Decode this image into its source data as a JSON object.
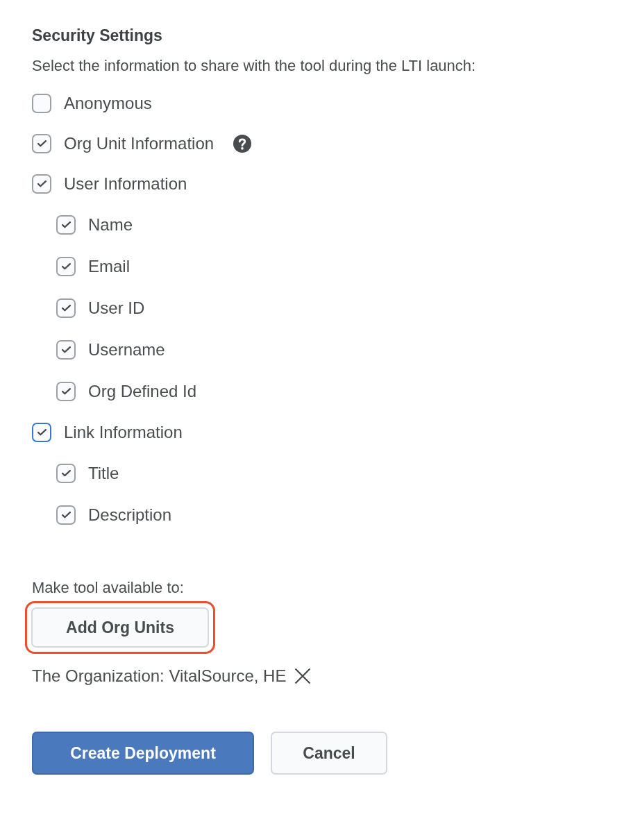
{
  "heading": "Security Settings",
  "instructions": "Select the information to share with the tool during the LTI launch:",
  "options": [
    {
      "label": "Anonymous",
      "checked": false,
      "focused": false,
      "help": false
    },
    {
      "label": "Org Unit Information",
      "checked": true,
      "focused": false,
      "help": true
    },
    {
      "label": "User Information",
      "checked": true,
      "focused": false,
      "help": false,
      "children": [
        {
          "label": "Name",
          "checked": true,
          "focused": false,
          "help": false
        },
        {
          "label": "Email",
          "checked": true,
          "focused": false,
          "help": false
        },
        {
          "label": "User ID",
          "checked": true,
          "focused": false,
          "help": false
        },
        {
          "label": "Username",
          "checked": true,
          "focused": false,
          "help": false
        },
        {
          "label": "Org Defined Id",
          "checked": true,
          "focused": false,
          "help": false
        }
      ]
    },
    {
      "label": "Link Information",
      "checked": true,
      "focused": true,
      "help": false,
      "children": [
        {
          "label": "Title",
          "checked": true,
          "focused": false,
          "help": false
        },
        {
          "label": "Description",
          "checked": true,
          "focused": false,
          "help": false
        }
      ]
    }
  ],
  "availability": {
    "label": "Make tool available to:",
    "button": {
      "label": "Add Org Units",
      "highlighted": true
    },
    "org_unit": "The Organization: VitalSource, HE"
  },
  "buttons": [
    {
      "label": "Create Deployment",
      "kind": "primary"
    },
    {
      "label": "Cancel",
      "kind": "secondary"
    }
  ]
}
